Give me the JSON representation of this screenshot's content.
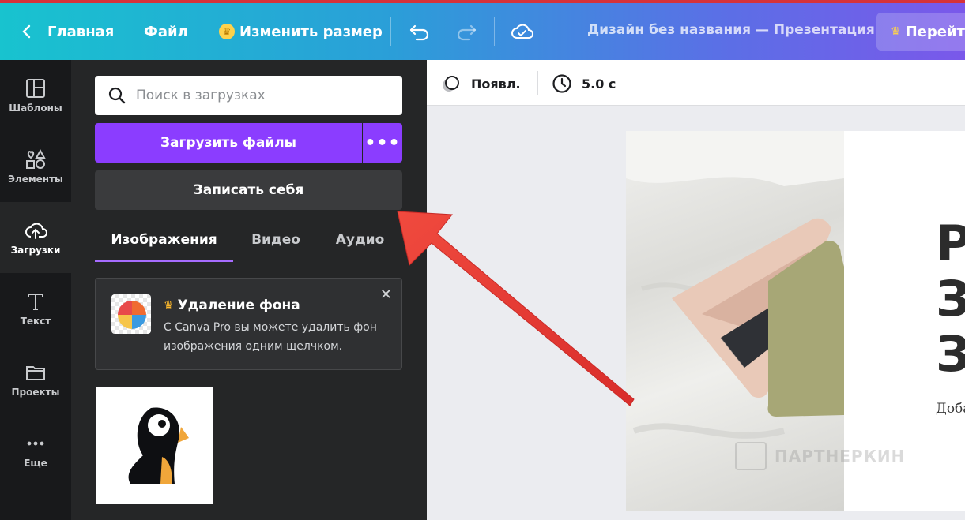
{
  "topbar": {
    "back_label": "Главная",
    "file_label": "Файл",
    "resize_label": "Изменить размер",
    "doc_title": "Дизайн без названия — Презентация",
    "go_label": "Перейт"
  },
  "rail": {
    "items": [
      {
        "label": "Шаблоны",
        "icon": "templates-icon"
      },
      {
        "label": "Элементы",
        "icon": "elements-icon"
      },
      {
        "label": "Загрузки",
        "icon": "upload-cloud-icon"
      },
      {
        "label": "Текст",
        "icon": "text-icon"
      },
      {
        "label": "Проекты",
        "icon": "folder-icon"
      },
      {
        "label": "Еще",
        "icon": "more-icon"
      }
    ]
  },
  "panel": {
    "search_placeholder": "Поиск в загрузках",
    "upload_label": "Загрузить файлы",
    "upload_more": "•••",
    "record_label": "Записать себя",
    "tabs": [
      {
        "label": "Изображения"
      },
      {
        "label": "Видео"
      },
      {
        "label": "Аудио"
      }
    ],
    "promo": {
      "title": "Удаление фона",
      "text": "С Canva Pro вы можете удалить фон изображения одним щелчком.",
      "close": "✕"
    },
    "collapse": "‹"
  },
  "editor": {
    "animate_label": "Появл.",
    "duration_label": "5.0 с",
    "slide": {
      "line1": "Р",
      "line2": "З",
      "line3": "З",
      "subtext": "Доба"
    },
    "watermark": "ПАРТНЕРКИН"
  },
  "colors": {
    "accent": "#8b3dff",
    "arrow": "#e53935",
    "crown": "#fdd24c"
  }
}
